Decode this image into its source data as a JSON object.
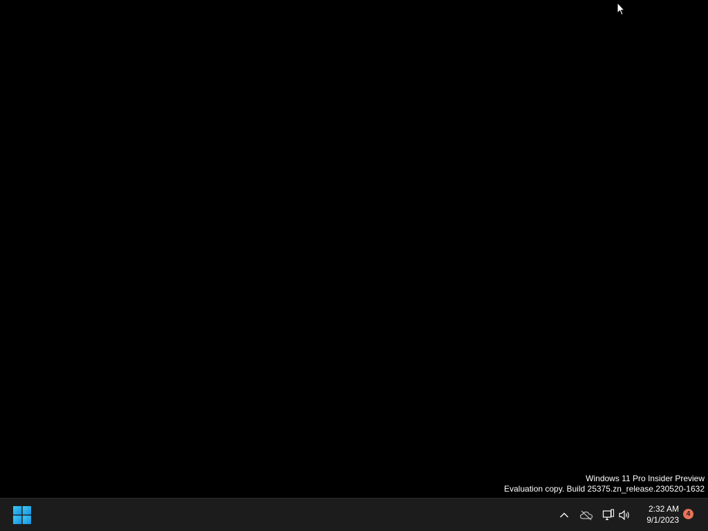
{
  "desktop": {
    "watermark_line1": "Windows 11 Pro Insider Preview",
    "watermark_line2": "Evaluation copy. Build 25375.zn_release.230520-1632"
  },
  "taskbar": {
    "start_icon": "windows-logo-icon",
    "tray": {
      "chevron_icon": "chevron-up-icon",
      "onedrive_icon": "onedrive-cloud-offline-icon",
      "network_icon": "network-icon",
      "volume_icon": "speaker-icon"
    },
    "clock": {
      "time": "2:32 AM",
      "date": "9/1/2023"
    },
    "notifications": {
      "count": "4",
      "color": "#e8735a"
    }
  },
  "colors": {
    "desktop_bg": "#000000",
    "taskbar_bg": "#1c1c1c",
    "start_accent": "#29b6f6"
  }
}
